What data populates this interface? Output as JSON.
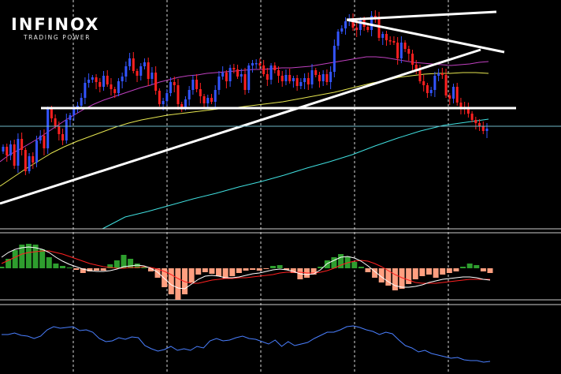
{
  "logo": {
    "name": "INFINOX",
    "tagline": "TRADING POWER"
  },
  "colors": {
    "background": "#000000",
    "bull": "#ff2020",
    "bear": "#3355ff",
    "ma_fast": "#c040c0",
    "ma_mid": "#e6e650",
    "ma_slow": "#40e0e0",
    "trendline": "#ffffff",
    "horizontal_level": "#ffffff",
    "current_price_line": "#6fb8c8",
    "grid": "#ffffff",
    "macd_pos": "#2e9e2e",
    "macd_neg": "#ff9f80",
    "macd_line": "#ffffff",
    "signal_line": "#ff2020",
    "rsi_line": "#4a7fff"
  },
  "chart_data": {
    "type": "candlestick",
    "title": "",
    "xlabel": "",
    "ylabel": "",
    "grid": "vertical dashed",
    "price_scale": "unlabelled",
    "panels": [
      "price",
      "macd",
      "rsi"
    ],
    "candles_close": [
      186,
      197,
      183,
      210,
      176,
      190,
      217,
      198,
      206,
      178,
      172,
      188,
      138,
      150,
      160,
      170,
      178,
      152,
      146,
      138,
      134,
      124,
      105,
      101,
      98,
      104,
      110,
      96,
      107,
      113,
      118,
      103,
      97,
      84,
      74,
      90,
      96,
      84,
      79,
      100,
      92,
      115,
      132,
      128,
      118,
      104,
      108,
      132,
      137,
      126,
      114,
      101,
      113,
      122,
      131,
      124,
      129,
      114,
      97,
      92,
      103,
      86,
      88,
      97,
      94,
      114,
      83,
      80,
      80,
      83,
      94,
      101,
      83,
      89,
      96,
      103,
      95,
      103,
      99,
      109,
      104,
      99,
      107,
      89,
      95,
      103,
      94,
      104,
      91,
      58,
      40,
      36,
      27,
      24,
      35,
      38,
      25,
      34,
      38,
      20,
      23,
      48,
      43,
      51,
      52,
      54,
      74,
      54,
      62,
      68,
      82,
      89,
      103,
      108,
      118,
      114,
      96,
      93,
      95,
      121,
      125,
      110,
      130,
      136,
      138,
      144,
      152,
      156,
      160,
      166,
      163
    ],
    "candles_dir": [
      -1,
      1,
      -1,
      1,
      -1,
      1,
      1,
      -1,
      1,
      -1,
      -1,
      1,
      -1,
      1,
      1,
      1,
      1,
      -1,
      -1,
      -1,
      -1,
      -1,
      -1,
      -1,
      -1,
      1,
      1,
      -1,
      1,
      1,
      1,
      -1,
      -1,
      -1,
      -1,
      1,
      1,
      -1,
      -1,
      1,
      -1,
      1,
      1,
      -1,
      -1,
      -1,
      1,
      1,
      1,
      -1,
      -1,
      -1,
      1,
      1,
      1,
      -1,
      1,
      -1,
      -1,
      -1,
      1,
      -1,
      1,
      1,
      -1,
      1,
      -1,
      -1,
      -1,
      1,
      1,
      1,
      -1,
      1,
      1,
      1,
      -1,
      1,
      -1,
      1,
      -1,
      -1,
      1,
      -1,
      1,
      1,
      -1,
      1,
      -1,
      -1,
      -1,
      -1,
      -1,
      -1,
      1,
      1,
      -1,
      1,
      1,
      -1,
      1,
      1,
      -1,
      1,
      1,
      1,
      1,
      -1,
      1,
      1,
      1,
      1,
      1,
      1,
      1,
      -1,
      -1,
      -1,
      1,
      1,
      1,
      -1,
      1,
      1,
      1,
      1,
      1,
      1,
      1,
      1,
      -1
    ],
    "ma_fast": [
      205,
      196,
      190,
      183,
      176,
      168,
      160,
      152,
      145,
      138,
      132,
      127,
      123,
      119,
      115,
      111,
      108,
      104,
      101,
      98,
      96,
      95,
      93,
      92,
      91,
      90,
      89,
      88,
      88,
      87,
      86,
      86,
      85,
      84,
      82,
      80,
      78,
      76,
      74,
      72,
      72,
      73,
      75,
      77,
      79,
      80,
      81,
      82,
      83,
      82,
      81,
      79,
      78
    ],
    "ma_mid": [
      236,
      225,
      214,
      204,
      194,
      186,
      179,
      173,
      167,
      161,
      156,
      152,
      149,
      146,
      144,
      142,
      140,
      138,
      137,
      135,
      133,
      131,
      129,
      126,
      123,
      120,
      117,
      113,
      109,
      105,
      102,
      98,
      96,
      94,
      93,
      93,
      92,
      92,
      93
    ],
    "ma_slow": [
      290,
      275,
      268,
      260,
      252,
      245,
      237,
      230,
      222,
      213,
      205,
      196,
      185,
      175,
      166,
      159,
      155,
      151
    ],
    "trendlines": [
      {
        "from": [
          0,
          258
        ],
        "to": [
          61,
          63
        ],
        "label": ""
      },
      {
        "from": [
          44,
          25
        ],
        "to": [
          64,
          66
        ],
        "label": ""
      },
      {
        "from": [
          44,
          25
        ],
        "to": [
          63,
          15
        ],
        "label": ""
      }
    ],
    "horizontal_level": 137,
    "current_price": 160,
    "macd_histogram": [
      2,
      12,
      23,
      30,
      31,
      30,
      24,
      14,
      6,
      3,
      1,
      -2,
      -6,
      -4,
      -3,
      -3,
      5,
      10,
      17,
      12,
      6,
      2,
      -4,
      -12,
      -24,
      -33,
      -40,
      -33,
      -18,
      -8,
      -5,
      -7,
      -10,
      -13,
      -10,
      -6,
      -3,
      -2,
      -3,
      -1,
      3,
      4,
      -2,
      -6,
      -14,
      -12,
      -8,
      2,
      10,
      14,
      18,
      15,
      8,
      2,
      -5,
      -12,
      -18,
      -22,
      -28,
      -26,
      -20,
      -14,
      -10,
      -8,
      -12,
      -8,
      -6,
      -4,
      2,
      6,
      4,
      -4,
      -6
    ],
    "macd_line": [
      14,
      20,
      24,
      26,
      27,
      26,
      24,
      20,
      14,
      9,
      5,
      2,
      -1,
      -3,
      -4,
      -4,
      -3,
      -1,
      2,
      3,
      4,
      3,
      0,
      -5,
      -13,
      -21,
      -25,
      -26,
      -20,
      -14,
      -10,
      -9,
      -10,
      -12,
      -12,
      -11,
      -9,
      -7,
      -6,
      -4,
      -2,
      -1,
      -2,
      -4,
      -7,
      -8,
      -7,
      -2,
      6,
      10,
      14,
      15,
      13,
      9,
      3,
      -4,
      -11,
      -17,
      -22,
      -24,
      -24,
      -23,
      -21,
      -18,
      -16,
      -14,
      -13,
      -12,
      -11,
      -11,
      -12,
      -14,
      -15
    ],
    "signal_line": [
      6,
      10,
      14,
      18,
      20,
      21,
      22,
      22,
      20,
      18,
      15,
      12,
      9,
      6,
      4,
      2,
      1,
      0,
      0,
      1,
      1,
      2,
      1,
      -1,
      -4,
      -8,
      -13,
      -17,
      -19,
      -19,
      -17,
      -15,
      -14,
      -13,
      -13,
      -12,
      -12,
      -11,
      -10,
      -9,
      -8,
      -6,
      -5,
      -5,
      -5,
      -6,
      -6,
      -5,
      -3,
      0,
      4,
      7,
      9,
      10,
      9,
      6,
      2,
      -3,
      -8,
      -12,
      -15,
      -18,
      -19,
      -19,
      -19,
      -18,
      -17,
      -16,
      -15,
      -14,
      -14,
      -14,
      -14
    ],
    "rsi": [
      52,
      52,
      54,
      51,
      50,
      47,
      50,
      58,
      62,
      60,
      61,
      62,
      57,
      58,
      55,
      47,
      43,
      44,
      48,
      46,
      49,
      48,
      38,
      34,
      31,
      33,
      37,
      32,
      34,
      32,
      37,
      35,
      44,
      47,
      44,
      45,
      48,
      50,
      47,
      46,
      43,
      40,
      45,
      37,
      43,
      38,
      40,
      42,
      47,
      51,
      55,
      55,
      58,
      62,
      63,
      61,
      58,
      56,
      52,
      55,
      53,
      45,
      38,
      35,
      30,
      32,
      28,
      26,
      24,
      22,
      23,
      20,
      19,
      19,
      17,
      18
    ]
  }
}
